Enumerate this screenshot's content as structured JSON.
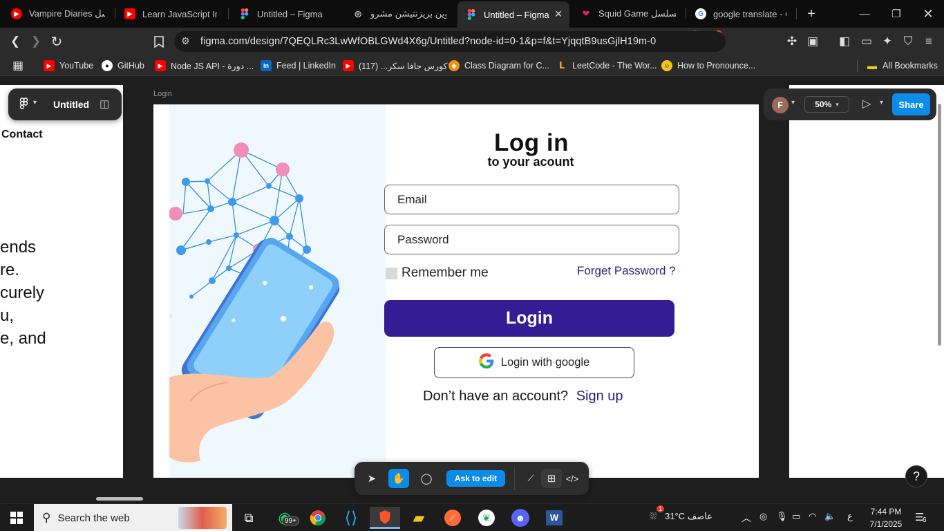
{
  "browser": {
    "tabs": [
      {
        "title": "Vampire Diaries مسلسل",
        "favicon": "youtube-icon",
        "color": "#ff0000"
      },
      {
        "title": "Learn JavaScript In Ar",
        "favicon": "youtube-icon",
        "color": "#ff0000"
      },
      {
        "title": "Untitled – Figma",
        "favicon": "figma-icon",
        "color": "#a259ff"
      },
      {
        "title": "عناوين بريزنتيشن مشرو",
        "favicon": "chatgpt-icon",
        "color": "#ffffff"
      },
      {
        "title": "Untitled – Figma",
        "favicon": "figma-icon",
        "color": "#a259ff",
        "active": true
      },
      {
        "title": "Squid Game مسلسل",
        "favicon": "heart-icon",
        "color": "#e0245e"
      },
      {
        "title": "google translate - Goo",
        "favicon": "google-icon",
        "color": "#ffffff"
      }
    ],
    "url": "figma.com/design/7QEQLRc3LwWfOBLGWd4X6g/Untitled?node-id=0-1&p=f&t=YjqqtB9usGjlH19m-0",
    "brave_badge": "2",
    "rewards_badge": "1",
    "bookmarks": [
      {
        "label": "YouTube",
        "icon": "youtube-icon",
        "color": "#ff0000"
      },
      {
        "label": "GitHub",
        "icon": "github-icon",
        "color": "#ffffff"
      },
      {
        "label": "Node JS API - دورة ...",
        "icon": "youtube-icon",
        "color": "#ff0000"
      },
      {
        "label": "Feed | LinkedIn",
        "icon": "linkedin-icon",
        "color": "#0a66c2"
      },
      {
        "label": "كورس جافا سكر... (117)",
        "icon": "youtube-icon",
        "color": "#ff0000"
      },
      {
        "label": "Class Diagram for C...",
        "icon": "class-diagram-icon",
        "color": "#f29111"
      },
      {
        "label": "LeetCode - The Wor...",
        "icon": "leetcode-icon",
        "color": "#ffa116"
      },
      {
        "label": "How to Pronounce...",
        "icon": "pronounce-icon",
        "color": "#f5c518"
      }
    ],
    "all_bookmarks": "All Bookmarks"
  },
  "figma": {
    "file_name": "Untitled",
    "avatar_initial": "F",
    "zoom": "50%",
    "share_label": "Share",
    "ask_to_edit": "Ask to edit",
    "help": "?",
    "frame_label": "Login",
    "left_frame": {
      "contact": "Contact",
      "lines": [
        "ends",
        "re.",
        "curely",
        "u,",
        "e, and"
      ]
    }
  },
  "login": {
    "title": "Log  in",
    "subtitle": "to your acount",
    "email_placeholder": "Email",
    "password_placeholder": "Password",
    "remember_me": "Remember me",
    "forgot_password": "Forget Password ?",
    "login_button": "Login",
    "google_button": "Login with google",
    "no_account": "Don’t have an account?",
    "sign_up": "Sign up",
    "colors": {
      "primary": "#341c94",
      "link": "#2e1a7a"
    }
  },
  "taskbar": {
    "search_placeholder": "Search the web",
    "whatsapp_badge": "99+",
    "weather": "31°C  عاصف",
    "weather_badge": "1",
    "lang": "ع",
    "time": "7:44 PM",
    "date": "7/1/2025",
    "notifications": "6"
  }
}
